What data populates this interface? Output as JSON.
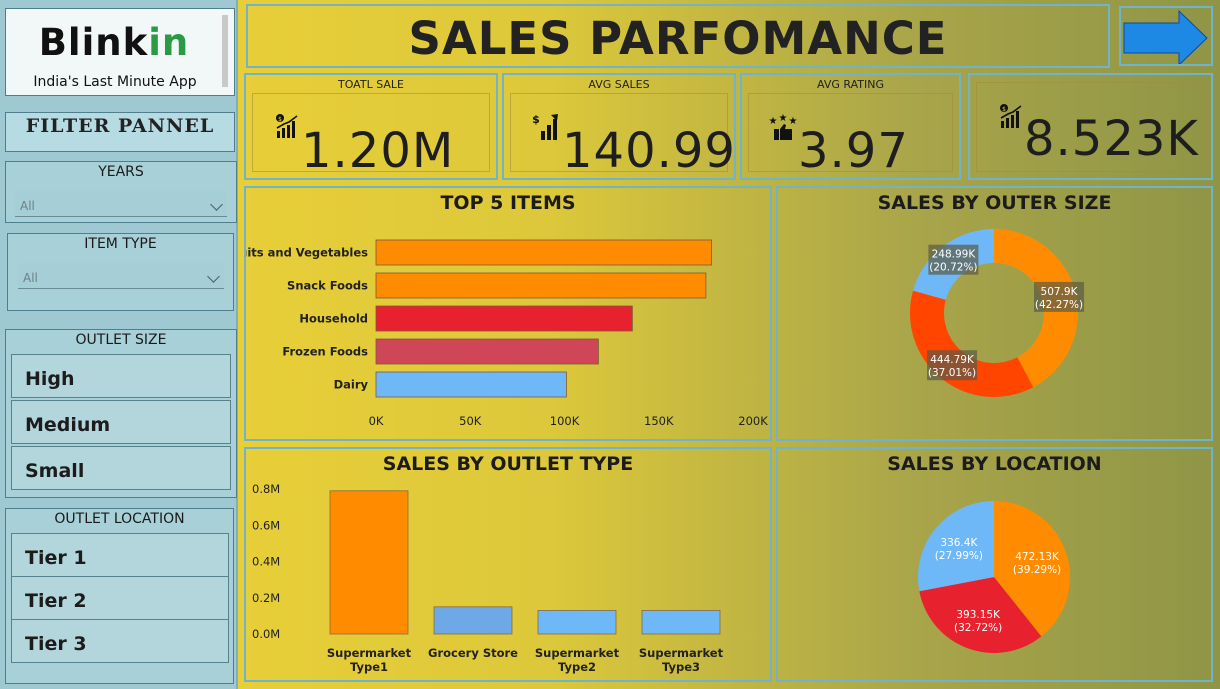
{
  "logo": {
    "name_main": "Blink",
    "name_accent": "in",
    "tagline": "India's Last Minute App"
  },
  "sidebar": {
    "filter_title": "FILTER PANNEL",
    "years": {
      "title": "YEARS",
      "value": "All"
    },
    "item_type": {
      "title": "ITEM TYPE",
      "value": "All"
    },
    "outlet_size": {
      "title": "OUTLET SIZE",
      "options": [
        "High",
        "Medium",
        "Small"
      ]
    },
    "outlet_location": {
      "title": "OUTLET LOCATION",
      "options": [
        "Tier 1",
        "Tier 2",
        "Tier 3"
      ]
    }
  },
  "header": {
    "title": "SALES PARFOMANCE",
    "nav_icon": "arrow-right-icon"
  },
  "kpis": [
    {
      "label": "TOATL SALE",
      "value": "1.20M",
      "icon": "sales-growth-icon"
    },
    {
      "label": "AVG SALES",
      "value": "140.99",
      "icon": "dollar-bars-icon"
    },
    {
      "label": "AVG RATING",
      "value": "3.97",
      "icon": "stars-thumb-icon"
    },
    {
      "label": "",
      "value": "8.523K",
      "icon": "sales-growth-icon"
    }
  ],
  "colors": {
    "orange": "#ff8c00",
    "red_orange": "#ff4500",
    "red": "#e8212e",
    "rose": "#cf4659",
    "light_blue": "#6fb8f8",
    "steel_blue": "#6ea8e6",
    "accent_border": "#6fb4c9",
    "arrow_blue": "#1e88e5"
  },
  "chart_data": [
    {
      "type": "bar",
      "orientation": "horizontal",
      "title": "TOP 5 ITEMS",
      "categories": [
        "Fruits and Vegetables",
        "Snack Foods",
        "Household",
        "Frozen Foods",
        "Dairy"
      ],
      "values": [
        178,
        175,
        136,
        118,
        101
      ],
      "value_unit": "K",
      "x_ticks": [
        "0K",
        "50K",
        "100K",
        "150K",
        "200K"
      ],
      "xlim": [
        0,
        200
      ],
      "grid": false
    },
    {
      "type": "pie",
      "style": "donut",
      "title": "SALES BY OUTER SIZE",
      "labels": [
        "507.9K (42.27%)",
        "444.79K (37.01%)",
        "248.99K (20.72%)"
      ],
      "values": [
        507.9,
        444.79,
        248.99
      ],
      "percents": [
        42.27,
        37.01,
        20.72
      ]
    },
    {
      "type": "bar",
      "title": "SALES BY OUTLET TYPE",
      "categories": [
        "Supermarket Type1",
        "Grocery Store",
        "Supermarket Type2",
        "Supermarket Type3"
      ],
      "category_lines": [
        [
          "Supermarket",
          "Type1"
        ],
        [
          "Grocery Store"
        ],
        [
          "Supermarket",
          "Type2"
        ],
        [
          "Supermarket",
          "Type3"
        ]
      ],
      "values": [
        0.79,
        0.15,
        0.13,
        0.13
      ],
      "value_unit": "M",
      "y_ticks": [
        "0.0M",
        "0.2M",
        "0.4M",
        "0.6M",
        "0.8M"
      ],
      "ylim": [
        0,
        0.8
      ],
      "grid": false
    },
    {
      "type": "pie",
      "title": "SALES BY LOCATION",
      "labels": [
        "472.13K (39.29%)",
        "393.15K (32.72%)",
        "336.4K (27.99%)"
      ],
      "values": [
        472.13,
        393.15,
        336.4
      ],
      "percents": [
        39.29,
        32.72,
        27.99
      ]
    }
  ]
}
